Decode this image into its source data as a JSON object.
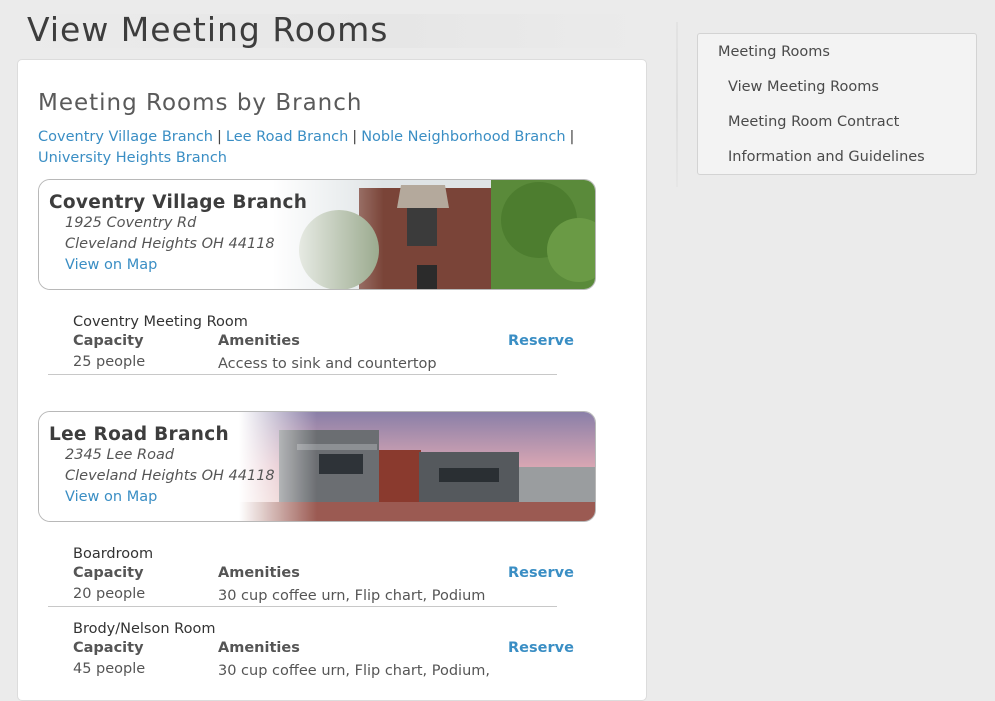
{
  "page": {
    "title": "View Meeting Rooms"
  },
  "main": {
    "heading": "Meeting Rooms by Branch",
    "branch_links": [
      "Coventry Village Branch",
      "Lee Road Branch",
      "Noble Neighborhood Branch",
      "University Heights Branch"
    ],
    "branches": [
      {
        "name": "Coventry Village Branch",
        "address_line1": "1925 Coventry Rd",
        "address_line2": "Cleveland Heights OH 44118",
        "map_link": "View on Map",
        "rooms": [
          {
            "name": "Coventry Meeting Room",
            "capacity_label": "Capacity",
            "amenities_label": "Amenities",
            "capacity": "25 people",
            "amenities": "Access to sink and countertop",
            "reserve_label": "Reserve"
          }
        ]
      },
      {
        "name": "Lee Road Branch",
        "address_line1": "2345 Lee Road",
        "address_line2": "Cleveland Heights OH 44118",
        "map_link": "View on Map",
        "rooms": [
          {
            "name": "Boardroom",
            "capacity_label": "Capacity",
            "amenities_label": "Amenities",
            "capacity": "20 people",
            "amenities": "30 cup coffee urn, Flip chart, Podium",
            "reserve_label": "Reserve"
          },
          {
            "name": "Brody/Nelson Room",
            "capacity_label": "Capacity",
            "amenities_label": "Amenities",
            "capacity": "45 people",
            "amenities": "30 cup coffee urn, Flip chart, Podium,",
            "reserve_label": "Reserve"
          }
        ]
      }
    ]
  },
  "sidebar": {
    "items": [
      {
        "label": "Meeting Rooms"
      },
      {
        "label": "View Meeting Rooms"
      },
      {
        "label": "Meeting Room Contract"
      },
      {
        "label": "Information and Guidelines"
      }
    ]
  },
  "colors": {
    "link": "#3a8ec4",
    "background": "#ebebeb",
    "card": "#ffffff"
  }
}
